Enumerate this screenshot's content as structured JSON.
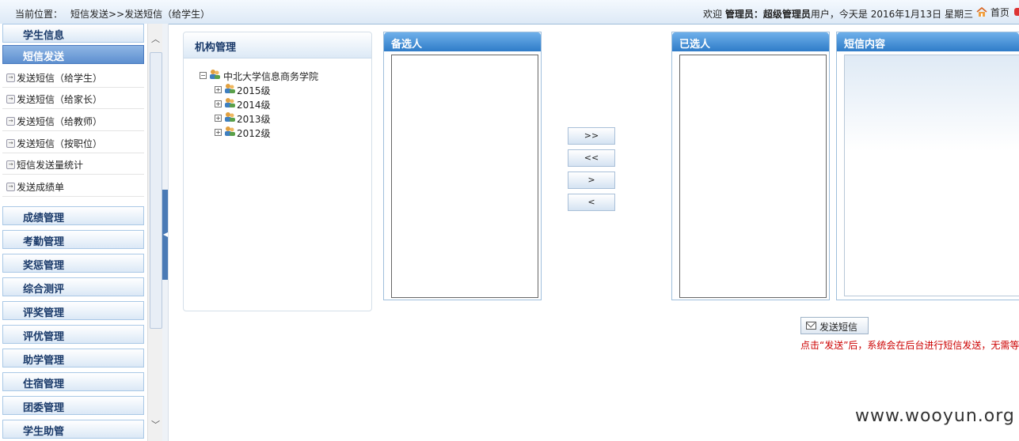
{
  "topbar": {
    "location_label": "当前位置：",
    "location_path": "短信发送>>发送短信（给学生）",
    "welcome_prefix": "欢迎",
    "role": "管理员：",
    "user": "超级管理员",
    "welcome_suffix": "用户，今天是 2016年1月13日 星期三",
    "home_label": "首页"
  },
  "sidebar": {
    "sections": [
      {
        "label": "学生信息"
      },
      {
        "label": "短信发送",
        "active": true
      }
    ],
    "items": [
      {
        "label": "发送短信（给学生）"
      },
      {
        "label": "发送短信（给家长）"
      },
      {
        "label": "发送短信（给教师）"
      },
      {
        "label": "发送短信（按职位）"
      },
      {
        "label": "短信发送量统计"
      },
      {
        "label": "发送成绩单"
      }
    ],
    "modules": [
      {
        "label": "成绩管理"
      },
      {
        "label": "考勤管理"
      },
      {
        "label": "奖惩管理"
      },
      {
        "label": "综合测评"
      },
      {
        "label": "评奖管理"
      },
      {
        "label": "评优管理"
      },
      {
        "label": "助学管理"
      },
      {
        "label": "住宿管理"
      },
      {
        "label": "团委管理"
      },
      {
        "label": "学生助管"
      }
    ]
  },
  "org_panel": {
    "title": "机构管理",
    "root": "中北大学信息商务学院",
    "children": [
      "2015级",
      "2014级",
      "2013级",
      "2012级"
    ]
  },
  "candidates": {
    "title": "备选人"
  },
  "selected": {
    "title": "已选人"
  },
  "sms": {
    "title": "短信内容"
  },
  "move_buttons": [
    ">>",
    "<<",
    ">",
    "<"
  ],
  "send": {
    "label": "发送短信",
    "note": "点击“发送”后，系统会在后台进行短信发送，无需等待"
  },
  "watermark": "www.wooyun.org",
  "colors": {
    "header_blue": "#2f7cc8",
    "active_nav": "#5d8fd0",
    "note_red": "#cc0000"
  }
}
